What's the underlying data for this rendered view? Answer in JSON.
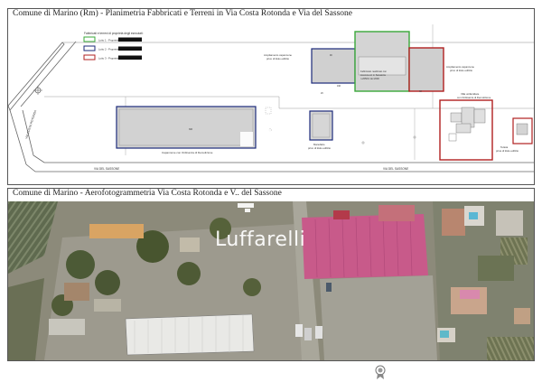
{
  "plan": {
    "title": "Comune di Marino (Rm) - Planimetria Fabbricati e Terreni in Via Costa Rotonda e Via del Sassone",
    "legend": {
      "heading": "Fabbricati e terreni di proprietà degli esecutati:",
      "items": [
        {
          "label": "Lotto 1 - Proprietà",
          "color": "#3aa83a"
        },
        {
          "label": "Lotto 2 - Proprietà",
          "color": "#1b2a7a"
        },
        {
          "label": "Lotto 3 - Proprietà",
          "color": "#b02020"
        }
      ]
    },
    "annotations": {
      "ampliamento_left": [
        "Ampliamento capannone",
        "privo di titolo edilizio"
      ],
      "fabbricato": [
        "Fabbricato realizzato con",
        "Licenza ed. in Sanatoria",
        "n.2056/1 del 2000"
      ],
      "ampliamento_right": [
        "Ampliamento capannone",
        "privo di titolo edilizio"
      ],
      "villa": [
        "Villa unifamiliare",
        "con Ordinanza di Demolizione"
      ],
      "capannone": "Capannone con Ordinanza di Demolizione",
      "manufatto": [
        "Manufatto",
        "privo di titolo edilizio"
      ],
      "tettoia": [
        "Tettoia",
        "priva di titolo edilizio"
      ],
      "road_vertical": "VIA COSTA ROTONDA",
      "road_bottom_left": "VIA DEL SASSONE",
      "road_bottom_right": "VIA DEL SASSONE",
      "area_small_1": "90",
      "area_small_2": "196",
      "area_small_3": "26",
      "area_small_4": "48",
      "area_small_5": "306"
    }
  },
  "aerial": {
    "title": "Comune di Marino  - Aerofotogrammetria Via Costa Rotonda e V.. del Sassone",
    "watermark": "Luffarelli"
  },
  "colors": {
    "lotto1": "#3aa83a",
    "lotto2": "#1b2a7a",
    "lotto3": "#b02020",
    "building_fill": "#cfcfcf",
    "roof_magenta": "#c85a8a"
  }
}
